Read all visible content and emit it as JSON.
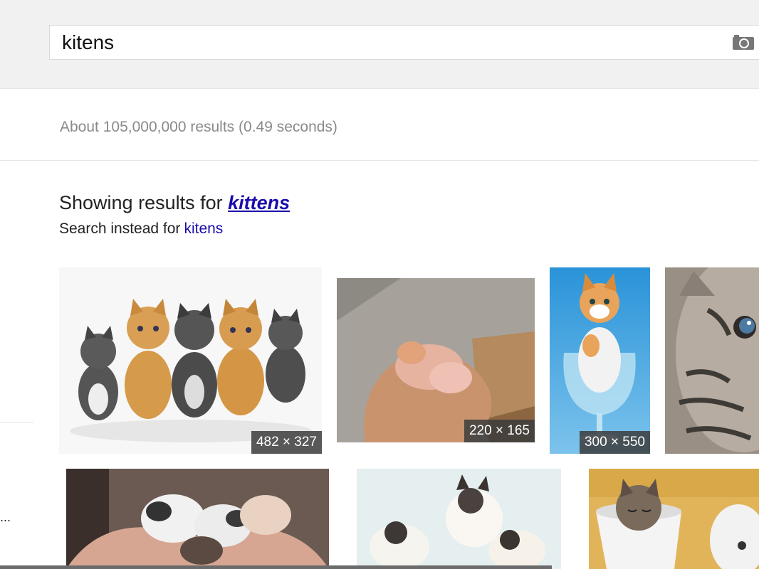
{
  "search": {
    "query": "kitens"
  },
  "stats": {
    "text": "About 105,000,000 results (0.49 seconds)"
  },
  "correction": {
    "showing_prefix": "Showing results for",
    "corrected_query": "kittens",
    "instead_prefix": "Search instead for",
    "original_query": "kitens"
  },
  "sidebar": {
    "ellipsis": "..."
  },
  "results": [
    {
      "dimensions": "482 × 327"
    },
    {
      "dimensions": "220 × 165"
    },
    {
      "dimensions": "300 × 550"
    }
  ],
  "icons": {
    "camera": "camera-icon"
  },
  "colors": {
    "link": "#1a0dab",
    "header_bg": "#f1f1f1"
  }
}
